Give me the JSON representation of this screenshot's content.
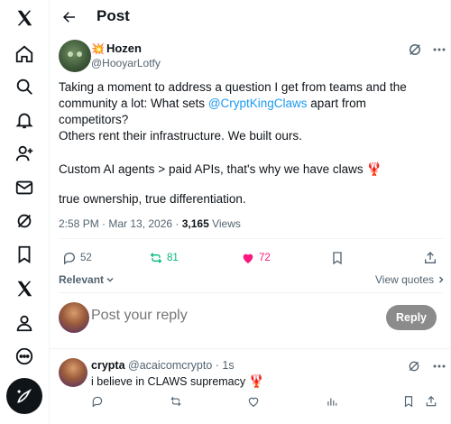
{
  "nav": {
    "items": [
      "x-logo-icon",
      "home-icon",
      "search-icon",
      "notifications-icon",
      "follow-icon",
      "messages-icon",
      "grok-icon",
      "bookmarks-icon",
      "premium-x-icon",
      "profile-icon",
      "more-icon"
    ]
  },
  "header": {
    "title": "Post"
  },
  "post": {
    "author_name": "Hozen",
    "author_emoji": "💥",
    "author_handle": "@HooyarLotfy",
    "text_p1_a": "Taking a moment to address a question I get from teams and the community a lot: What sets ",
    "mention": "@CryptKingClaws",
    "text_p1_b": "  apart from competitors?",
    "text_p2": "Others rent their infrastructure. We built ours.",
    "text_p3": "Custom AI agents > paid APIs, that's why we have claws ",
    "lobster": "🦞",
    "text_p4": "true ownership, true differentiation.",
    "time": "2:58 PM · Mar 13, 2026 · ",
    "views_count": "3,165",
    "views_label": " Views",
    "replies": "52",
    "reposts": "81",
    "likes": "72",
    "like_color": "#f91880",
    "repost_color": "#00ba7c"
  },
  "sort": {
    "label": "Relevant",
    "view_quotes": "View quotes"
  },
  "composer": {
    "placeholder": "Post your reply",
    "button": "Reply"
  },
  "comment": {
    "name": "crypta",
    "handle": "@acaicomcrypto",
    "time": " · 1s",
    "text": "i believe in CLAWS supremacy ",
    "lobster": "🦞"
  }
}
